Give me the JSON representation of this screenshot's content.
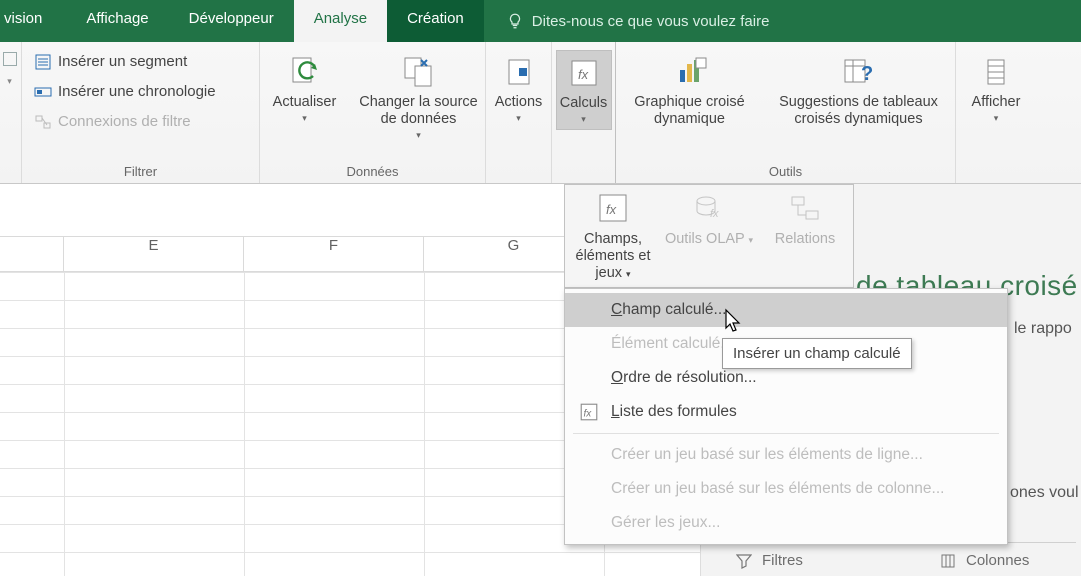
{
  "tabs": {
    "t0": "vision",
    "t1": "Affichage",
    "t2": "Développeur",
    "t3": "Analyse",
    "t4": "Création",
    "tellme": "Dites-nous ce que vous voulez faire"
  },
  "filtrer": {
    "seg": "Insérer un segment",
    "chrono": "Insérer une chronologie",
    "conn": "Connexions de filtre",
    "label": "Filtrer"
  },
  "donnees": {
    "actualiser": "Actualiser",
    "changer": "Changer la source de données",
    "label": "Données"
  },
  "actions": "Actions",
  "calculs": "Calculs",
  "pivotchart": "Graphique croisé dynamique",
  "suggest": "Suggestions de tableaux croisés dynamiques",
  "outils_label": "Outils",
  "afficher": "Afficher",
  "gallery": {
    "cej": "Champs, éléments et jeux",
    "olap": "Outils OLAP",
    "rel": "Relations"
  },
  "menu": {
    "champ": "Champ calculé...",
    "elem": "Élément calculé...",
    "ordre": "Ordre de résolution...",
    "liste": "Liste des formules",
    "jeu_ligne": "Créer un jeu basé sur les éléments de ligne...",
    "jeu_col": "Créer un jeu basé sur les éléments de colonne...",
    "gerer": "Gérer les jeux..."
  },
  "tooltip": "Insérer un champ calculé",
  "cols": {
    "E": "E",
    "F": "F",
    "G": "G"
  },
  "right": {
    "frag1": "de tableau croisé",
    "frag2": "le rappo",
    "frag3": "ones voul",
    "filtres": "Filtres",
    "colonnes": "Colonnes"
  }
}
